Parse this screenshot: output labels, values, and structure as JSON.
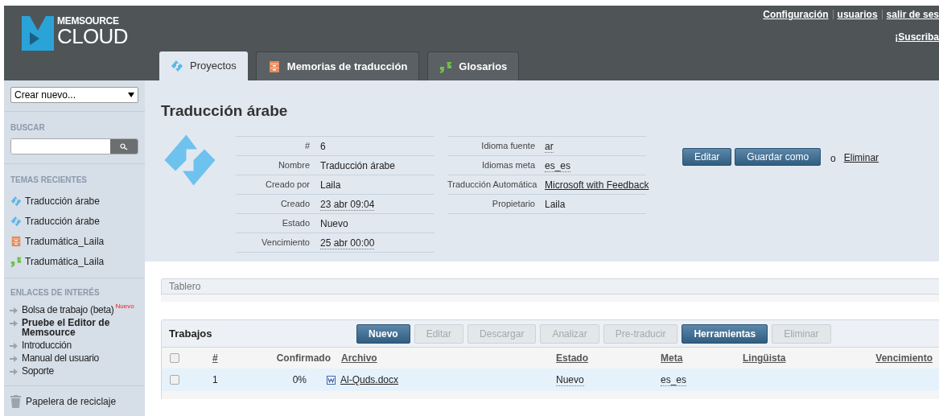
{
  "header": {
    "logo_top": "MEMSOURCE",
    "logo_bottom": "CLOUD",
    "top_links": [
      {
        "label": "Configuración"
      },
      {
        "label": "usuarios"
      },
      {
        "label": "salir de ses"
      }
    ],
    "subscribe_link": "¡Suscriba",
    "tabs": [
      {
        "label": "Proyectos",
        "kind": "project",
        "selected": true
      },
      {
        "label": "Memorias de traducción",
        "kind": "memory",
        "selected": false
      },
      {
        "label": "Glosarios",
        "kind": "glossary",
        "selected": false
      }
    ]
  },
  "sidebar": {
    "create_select": "Crear nuevo...",
    "search_heading": "BUSCAR",
    "recent_heading": "TEMAS RECIENTES",
    "recent": [
      {
        "label": "Traducción árabe",
        "kind": "project"
      },
      {
        "label": "Traducción árabe",
        "kind": "project"
      },
      {
        "label": "Tradumática_Laila",
        "kind": "memory"
      },
      {
        "label": "Tradumática_Laila",
        "kind": "glossary"
      }
    ],
    "links_heading": "ENLACES DE INTERÉS",
    "links": [
      {
        "label": "Bolsa de trabajo (beta)",
        "badge": "Nuevo",
        "bold": false
      },
      {
        "label": "Pruebe el Editor de Memsource",
        "bold": true
      },
      {
        "label": "Introducción",
        "bold": false
      },
      {
        "label": "Manual del usuario",
        "bold": false
      },
      {
        "label": "Soporte",
        "bold": false
      }
    ],
    "trash": "Papelera de reciclaje"
  },
  "project": {
    "title": "Traducción árabe",
    "details_left": [
      {
        "label": "#",
        "value": "6",
        "dotted": false
      },
      {
        "label": "Nombre",
        "value": "Traducción árabe",
        "dotted": false
      },
      {
        "label": "Creado por",
        "value": "Laila",
        "dotted": false
      },
      {
        "label": "Creado",
        "value": "23 abr 09:04",
        "dotted": true
      },
      {
        "label": "Estado",
        "value": "Nuevo",
        "dotted": false
      },
      {
        "label": "Vencimiento",
        "value": "25 abr 00:00",
        "dotted": true
      }
    ],
    "details_right": [
      {
        "label": "Idioma fuente",
        "value": "ar",
        "kind": "dotted"
      },
      {
        "label": "Idiomas meta",
        "value": "es_es",
        "kind": "dotted"
      },
      {
        "label": "Traducción Automática",
        "value": "Microsoft with Feedback",
        "kind": "link"
      },
      {
        "label": "Propietario",
        "value": "Laila",
        "kind": "plain"
      }
    ],
    "buttons": [
      "Editar",
      "Guardar como"
    ],
    "or_text": "o",
    "delete_link": "Eliminar"
  },
  "dashboard": {
    "title": "Tablero"
  },
  "jobs": {
    "title": "Trabajos",
    "buttons": [
      {
        "label": "Nuevo",
        "disabled": false
      },
      {
        "label": "Editar",
        "disabled": true
      },
      {
        "label": "Descargar",
        "disabled": true
      },
      {
        "label": "Analizar",
        "disabled": true
      },
      {
        "label": "Pre-traducir",
        "disabled": true
      },
      {
        "label": "Herramientas",
        "disabled": false
      },
      {
        "label": "Eliminar",
        "disabled": true
      }
    ],
    "columns": [
      {
        "label": "#",
        "sortable": true
      },
      {
        "label": "Confirmado",
        "sortable": false
      },
      {
        "label": "Archivo",
        "sortable": true
      },
      {
        "label": "Estado",
        "sortable": true
      },
      {
        "label": "Meta",
        "sortable": true
      },
      {
        "label": "Lingüista",
        "sortable": true
      },
      {
        "label": "Vencimiento",
        "sortable": true
      }
    ],
    "select_all_checked": false,
    "rows": [
      {
        "checked": false,
        "number": "1",
        "confirmed": "0%",
        "file": "Al-Quds.docx",
        "status": "Nuevo",
        "target": "es_es"
      }
    ]
  }
}
